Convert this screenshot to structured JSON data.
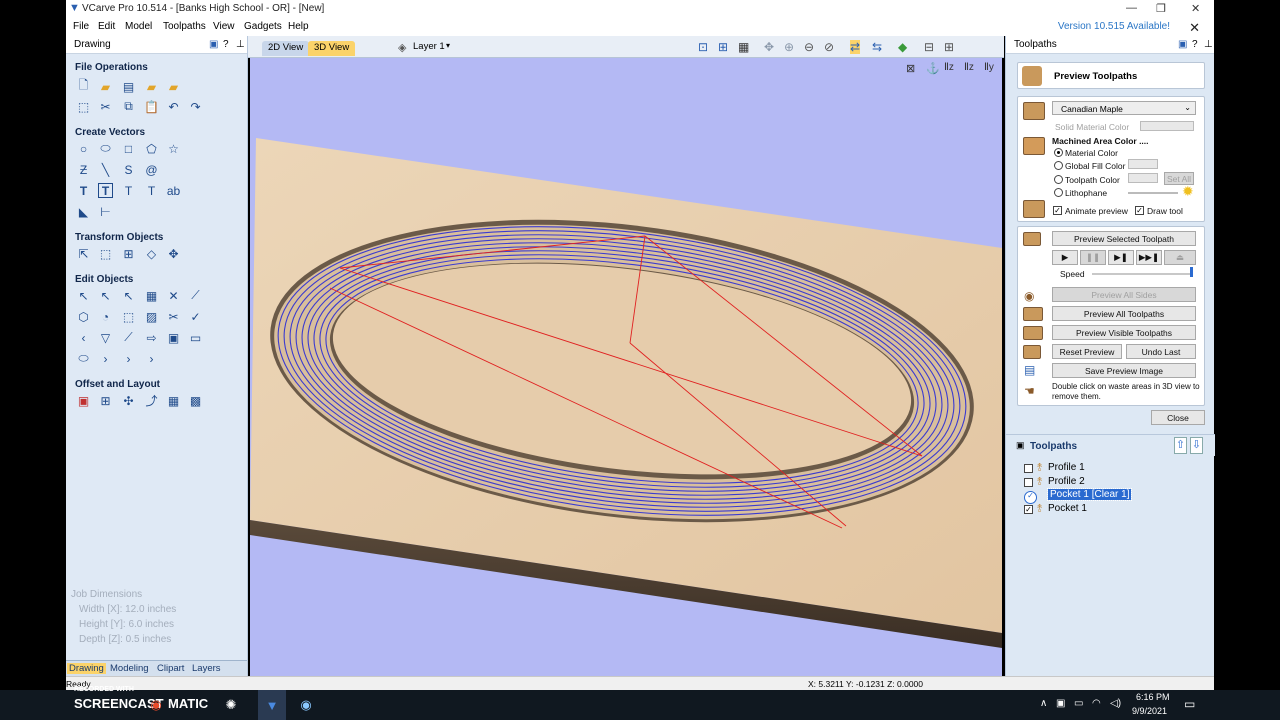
{
  "window": {
    "title": "VCarve Pro 10.514 - [Banks High School - OR] - [New]",
    "version_notice": "Version 10.515 Available!"
  },
  "menu": [
    "File",
    "Edit",
    "Model",
    "Toolpaths",
    "View",
    "Gadgets",
    "Help"
  ],
  "left_panel": {
    "title": "Drawing",
    "sections": {
      "file_operations": "File Operations",
      "create_vectors": "Create Vectors",
      "transform_objects": "Transform Objects",
      "edit_objects": "Edit Objects",
      "offset_layout": "Offset and Layout"
    },
    "job_dimensions": {
      "title": "Job Dimensions",
      "width": "Width  [X]: 12.0 inches",
      "height": "Height [Y]: 6.0 inches",
      "depth": "Depth  [Z]: 0.5 inches"
    },
    "tabs": [
      "Drawing",
      "Modeling",
      "Clipart",
      "Layers"
    ]
  },
  "view": {
    "tabs": [
      "2D View",
      "3D View"
    ],
    "active_tab": "3D View",
    "layer": "Layer 1"
  },
  "right_panel": {
    "title": "Toolpaths",
    "preview_title": "Preview Toolpaths",
    "material": "Canadian Maple",
    "solid_material_color": "Solid Material Color",
    "machined_area_title": "Machined Area Color ....",
    "radio_options": [
      "Material Color",
      "Global Fill Color",
      "Toolpath Color",
      "Lithophane"
    ],
    "set_all": "Set All",
    "animate_preview": "Animate preview",
    "draw_tool": "Draw tool",
    "buttons": {
      "preview_selected": "Preview Selected Toolpath",
      "speed": "Speed",
      "preview_all_sides": "Preview All Sides",
      "preview_all": "Preview All Toolpaths",
      "preview_visible": "Preview Visible Toolpaths",
      "reset_preview": "Reset Preview",
      "undo_last": "Undo Last",
      "save_preview_image": "Save Preview Image",
      "close": "Close"
    },
    "hint": "Double click on waste areas in 3D view to remove them.",
    "toolpaths_list_title": "Toolpaths",
    "toolpaths": [
      {
        "name": "Profile 1",
        "checked": false
      },
      {
        "name": "Profile 2",
        "checked": false
      },
      {
        "name": "Pocket 1 [Clear 1]",
        "checked": true,
        "selected": true
      },
      {
        "name": "Pocket 1",
        "checked": true
      }
    ]
  },
  "status": {
    "ready": "Ready",
    "coords": "X: 5.3211 Y: -0.1231 Z: 0.0000"
  },
  "taskbar": {
    "overlay": "RECORDED WITH",
    "brand": "SCREENCAST",
    "brand2": "MATIC",
    "time": "6:16 PM",
    "date": "9/9/2021"
  },
  "colors": {
    "viewport_bg": "#b4b9f4",
    "wood": "#e8cfae",
    "toolpath": "#3b3bd0",
    "rapid": "#e02020",
    "accent": "#fbd36a"
  }
}
